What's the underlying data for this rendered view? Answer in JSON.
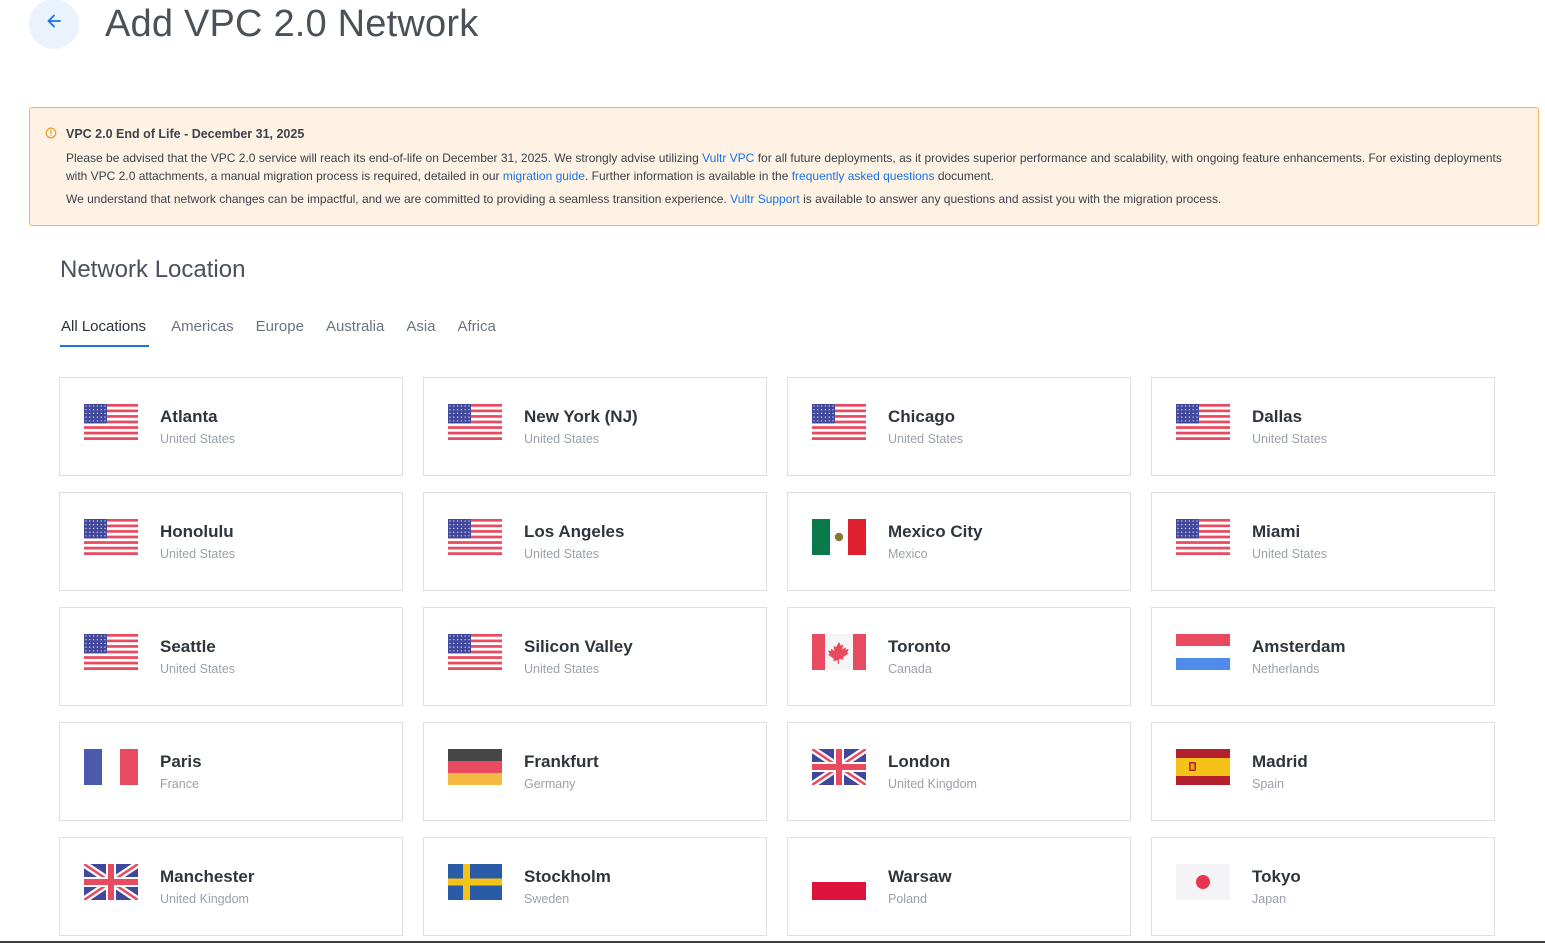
{
  "header": {
    "title": "Add VPC 2.0 Network",
    "back_icon": "arrow-left-icon"
  },
  "notice": {
    "icon": "info-circle-icon",
    "title": "VPC 2.0 End of Life - December 31, 2025",
    "p1_a": "Please be advised that the VPC 2.0 service will reach its end-of-life on December 31, 2025. We strongly advise utilizing ",
    "p1_link1": "Vultr VPC",
    "p1_b": " for all future deployments, as it provides superior performance and scalability, with ongoing feature enhancements. For existing deployments with VPC 2.0 attachments, a manual migration process is required, detailed in our ",
    "p1_link2": "migration guide",
    "p1_c": ". Further information is available in the ",
    "p1_link3": "frequently asked questions",
    "p1_d": " document.",
    "p2_a": "We understand that network changes can be impactful, and we are committed to providing a seamless transition experience. ",
    "p2_link": "Vultr Support",
    "p2_b": " is available to answer any questions and assist you with the migration process.",
    "colors": {
      "background": "#fef2e4",
      "border": "#f3b35a",
      "link": "#1a73e8"
    }
  },
  "section": {
    "title": "Network Location"
  },
  "tabs": [
    {
      "label": "All Locations",
      "active": true
    },
    {
      "label": "Americas",
      "active": false
    },
    {
      "label": "Europe",
      "active": false
    },
    {
      "label": "Australia",
      "active": false
    },
    {
      "label": "Asia",
      "active": false
    },
    {
      "label": "Africa",
      "active": false
    }
  ],
  "locations": [
    {
      "city": "Atlanta",
      "country": "United States",
      "flag": "us"
    },
    {
      "city": "New York (NJ)",
      "country": "United States",
      "flag": "us"
    },
    {
      "city": "Chicago",
      "country": "United States",
      "flag": "us"
    },
    {
      "city": "Dallas",
      "country": "United States",
      "flag": "us"
    },
    {
      "city": "Honolulu",
      "country": "United States",
      "flag": "us"
    },
    {
      "city": "Los Angeles",
      "country": "United States",
      "flag": "us"
    },
    {
      "city": "Mexico City",
      "country": "Mexico",
      "flag": "mx"
    },
    {
      "city": "Miami",
      "country": "United States",
      "flag": "us"
    },
    {
      "city": "Seattle",
      "country": "United States",
      "flag": "us"
    },
    {
      "city": "Silicon Valley",
      "country": "United States",
      "flag": "us"
    },
    {
      "city": "Toronto",
      "country": "Canada",
      "flag": "ca"
    },
    {
      "city": "Amsterdam",
      "country": "Netherlands",
      "flag": "nl"
    },
    {
      "city": "Paris",
      "country": "France",
      "flag": "fr"
    },
    {
      "city": "Frankfurt",
      "country": "Germany",
      "flag": "de"
    },
    {
      "city": "London",
      "country": "United Kingdom",
      "flag": "gb"
    },
    {
      "city": "Madrid",
      "country": "Spain",
      "flag": "es"
    },
    {
      "city": "Manchester",
      "country": "United Kingdom",
      "flag": "gb"
    },
    {
      "city": "Stockholm",
      "country": "Sweden",
      "flag": "se"
    },
    {
      "city": "Warsaw",
      "country": "Poland",
      "flag": "pl"
    },
    {
      "city": "Tokyo",
      "country": "Japan",
      "flag": "jp"
    }
  ]
}
